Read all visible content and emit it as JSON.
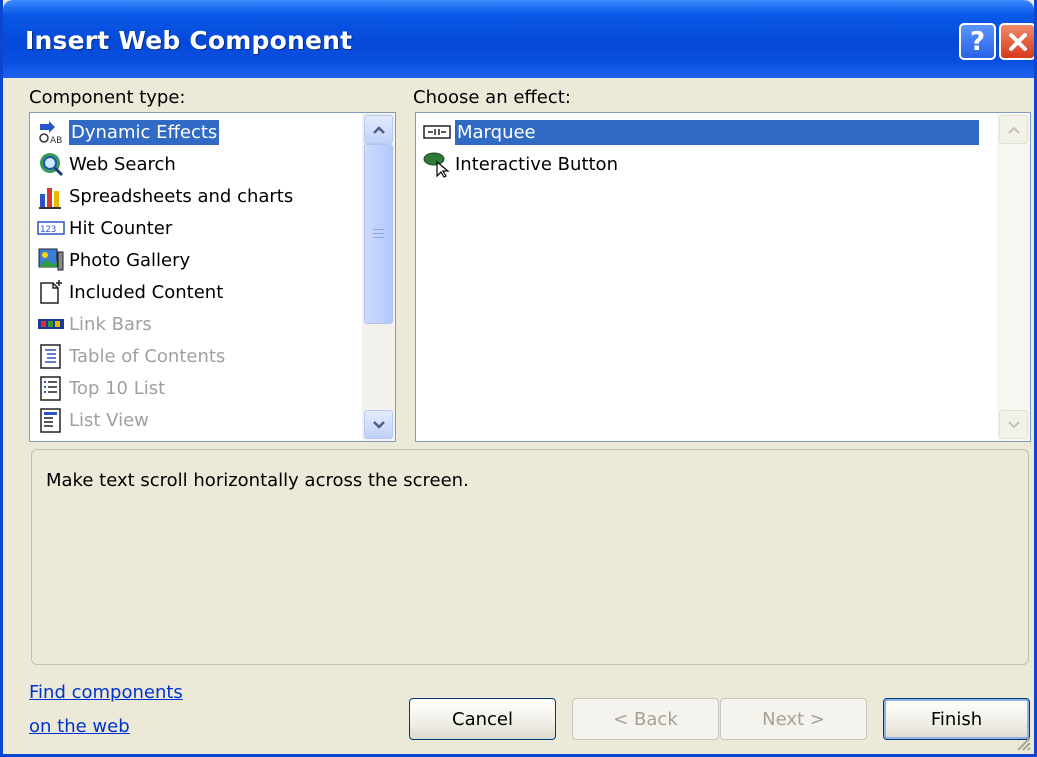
{
  "window": {
    "title": "Insert Web Component",
    "help_label": "?"
  },
  "component_type": {
    "label": "Component type:",
    "items": [
      {
        "label": "Dynamic Effects",
        "icon": "dynamic-effects-icon",
        "selected": true,
        "disabled": false
      },
      {
        "label": "Web Search",
        "icon": "web-search-icon",
        "selected": false,
        "disabled": false
      },
      {
        "label": "Spreadsheets and charts",
        "icon": "spreadsheet-chart-icon",
        "selected": false,
        "disabled": false
      },
      {
        "label": "Hit Counter",
        "icon": "hit-counter-icon",
        "selected": false,
        "disabled": false
      },
      {
        "label": "Photo Gallery",
        "icon": "photo-gallery-icon",
        "selected": false,
        "disabled": false
      },
      {
        "label": "Included Content",
        "icon": "included-content-icon",
        "selected": false,
        "disabled": false
      },
      {
        "label": "Link Bars",
        "icon": "link-bars-icon",
        "selected": false,
        "disabled": true
      },
      {
        "label": "Table of Contents",
        "icon": "table-of-contents-icon",
        "selected": false,
        "disabled": true
      },
      {
        "label": "Top 10 List",
        "icon": "top-10-list-icon",
        "selected": false,
        "disabled": true
      },
      {
        "label": "List View",
        "icon": "list-view-icon",
        "selected": false,
        "disabled": true
      }
    ]
  },
  "effect": {
    "label": "Choose an effect:",
    "items": [
      {
        "label": "Marquee",
        "icon": "marquee-icon",
        "selected": true
      },
      {
        "label": "Interactive Button",
        "icon": "interactive-button-icon",
        "selected": false
      }
    ]
  },
  "description": "Make text scroll horizontally across the screen.",
  "find_link": {
    "line1": "Find components",
    "line2": "on the web"
  },
  "buttons": {
    "cancel": "Cancel",
    "back": "< Back",
    "next": "Next >",
    "finish": "Finish"
  },
  "colors": {
    "title_bar": "#0548d8",
    "selection": "#316ac5",
    "dialog_bg": "#ece9d8",
    "link": "#0033cc"
  }
}
